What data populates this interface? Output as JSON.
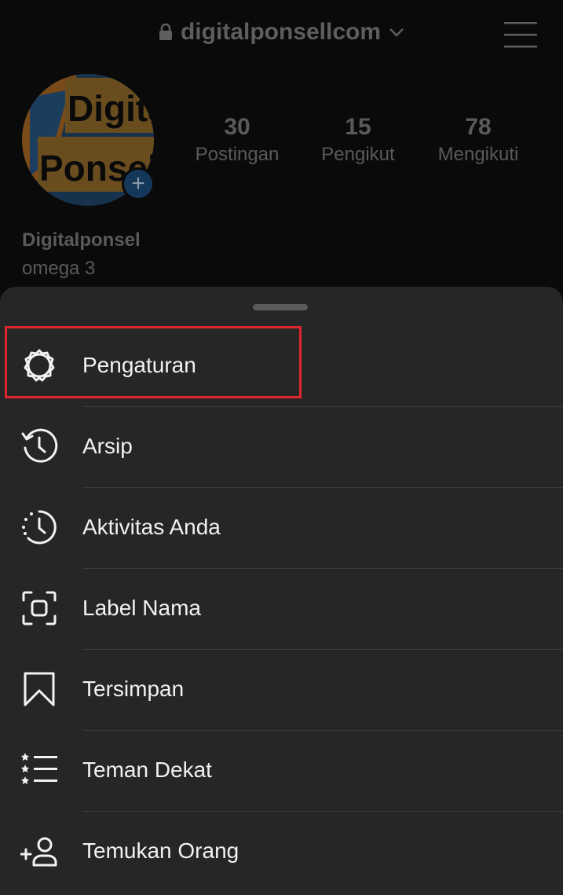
{
  "header": {
    "username": "digitalponsellcom"
  },
  "profile": {
    "avatar_text_line1": "Digital",
    "avatar_text_line2": "Ponsel",
    "stats": [
      {
        "value": "30",
        "label": "Postingan"
      },
      {
        "value": "15",
        "label": "Pengikut"
      },
      {
        "value": "78",
        "label": "Mengikuti"
      }
    ],
    "display_name": "Digitalponsel",
    "bio": "omega 3"
  },
  "menu": {
    "items": [
      {
        "label": "Pengaturan",
        "icon": "gear-icon"
      },
      {
        "label": "Arsip",
        "icon": "archive-history-icon"
      },
      {
        "label": "Aktivitas Anda",
        "icon": "activity-clock-icon"
      },
      {
        "label": "Label Nama",
        "icon": "nametag-scan-icon"
      },
      {
        "label": "Tersimpan",
        "icon": "bookmark-icon"
      },
      {
        "label": "Teman Dekat",
        "icon": "close-friends-list-icon"
      },
      {
        "label": "Temukan Orang",
        "icon": "add-person-icon"
      }
    ]
  },
  "colors": {
    "highlight": "#e0262d",
    "sheet_background": "#262626",
    "dimmed_text": "#5a5a5a"
  }
}
